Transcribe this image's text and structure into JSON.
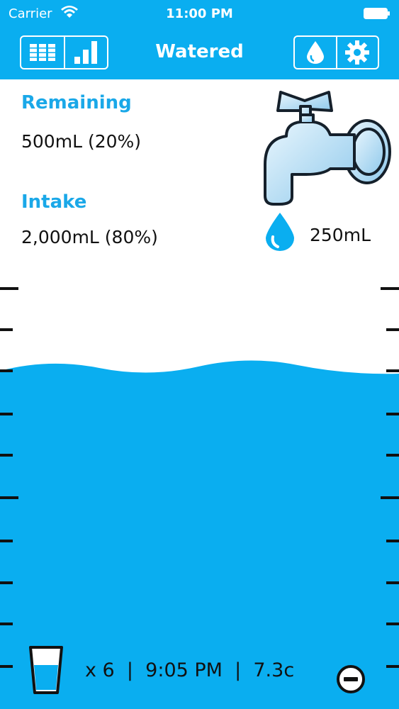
{
  "status_bar": {
    "carrier": "Carrier",
    "time": "11:00 PM"
  },
  "nav": {
    "title": "Watered",
    "left_buttons": [
      "table-icon",
      "chart-icon"
    ],
    "right_buttons": [
      "drop-icon",
      "gear-icon"
    ]
  },
  "remaining": {
    "label": "Remaining",
    "value": "500mL (20%)"
  },
  "intake": {
    "label": "Intake",
    "value": "2,000mL (80%)"
  },
  "serving": {
    "amount": "250mL"
  },
  "water_level_fraction": 0.8,
  "footer": {
    "summary": "x 6  |  9:05 PM  |  7.3c"
  },
  "colors": {
    "accent": "#0aaef0",
    "label": "#1aa8e8",
    "water": "#0aaef0"
  }
}
